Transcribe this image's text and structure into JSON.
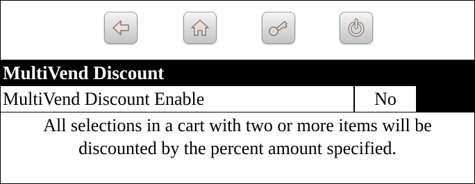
{
  "toolbar": {
    "buttons": [
      {
        "icon": "back-arrow-icon"
      },
      {
        "icon": "home-icon"
      },
      {
        "icon": "key-icon"
      },
      {
        "icon": "power-icon"
      }
    ],
    "button_color": "#d9d9d9",
    "icon_color": "#f1dcd0"
  },
  "section": {
    "title": "MultiVend Discount"
  },
  "setting": {
    "label": "MultiVend Discount Enable",
    "value": "No"
  },
  "description": {
    "text": "All selections in a cart with two or more items will be discounted by the percent amount specified."
  }
}
